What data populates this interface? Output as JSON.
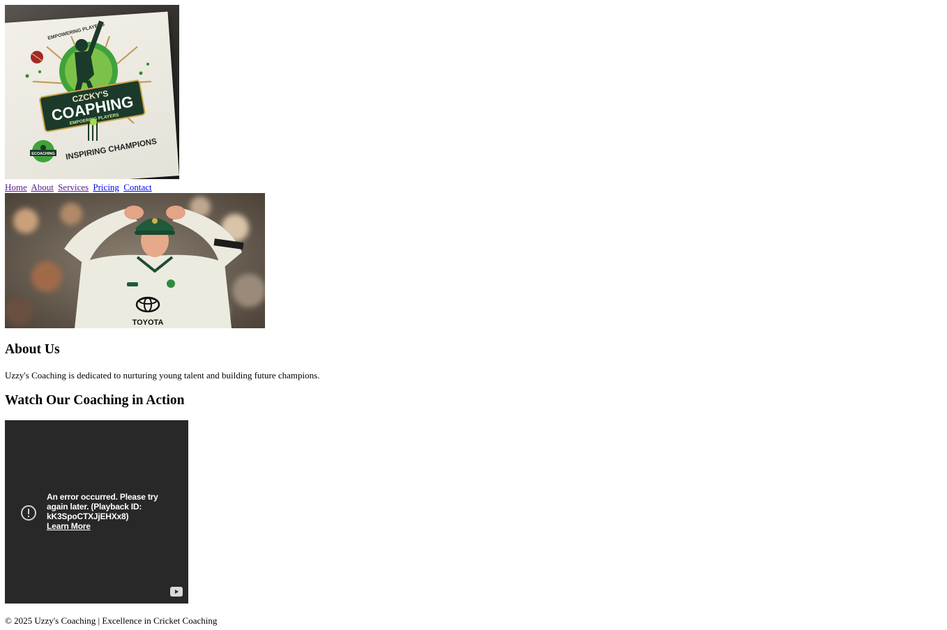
{
  "logo": {
    "alt": "Uzzy's Coaching logo",
    "arc_text": "EMPOWERING PLAYERS",
    "main_title": "CZCKY'S",
    "main_banner": "COAPHING",
    "banner_sub": "EMPOERING PLAYERS",
    "small_badge": "ECOACHING",
    "tagline": "INSPIRING CHAMPIONS"
  },
  "nav": {
    "items": [
      {
        "label": "Home",
        "state": "visited"
      },
      {
        "label": "About",
        "state": "visited"
      },
      {
        "label": "Services",
        "state": "visited"
      },
      {
        "label": "Pricing",
        "state": "unvisited"
      },
      {
        "label": "Contact",
        "state": "unvisited"
      }
    ]
  },
  "hero": {
    "alt": "Cricketer with hands on cap",
    "shirt_text": "TOYOTA"
  },
  "about": {
    "heading": "About Us",
    "text": "Uzzy's Coaching is dedicated to nurturing young talent and building future champions."
  },
  "video_section": {
    "heading": "Watch Our Coaching in Action",
    "error_message": "An error occurred. Please try again later. (Playback ID: kK3SpoCTXJjEHXx8)",
    "learn_more": "Learn More"
  },
  "footer": {
    "text": "© 2025 Uzzy's Coaching | Excellence in Cricket Coaching"
  },
  "colors": {
    "logo_green": "#2e8b2e",
    "logo_dark": "#1b3a2a",
    "video_bg": "#282828",
    "link_visited": "#551a8b",
    "link_unvisited": "#0000ee"
  }
}
